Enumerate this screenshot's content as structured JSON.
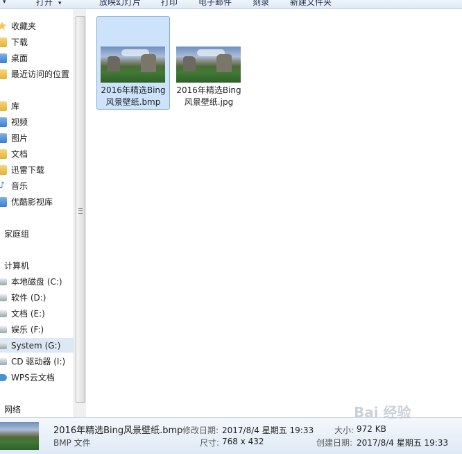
{
  "toolbar": {
    "items": [
      {
        "label": "打开"
      },
      {
        "label": "放映幻灯片"
      },
      {
        "label": "打印"
      },
      {
        "label": "电子邮件"
      },
      {
        "label": "刻录"
      },
      {
        "label": "新建文件夹"
      }
    ]
  },
  "nav": {
    "favorites": "收藏夹",
    "downloads": "下载",
    "desktop": "桌面",
    "recent": "最近访问的位置",
    "libraries": "库",
    "videos": "视频",
    "pictures": "图片",
    "documents": "文档",
    "xunlei": "迅雷下载",
    "music": "音乐",
    "youku": "优酷影视库",
    "homegroup": "家庭组",
    "computer": "计算机",
    "drive_c": "本地磁盘 (C:)",
    "drive_d": "软件 (D:)",
    "drive_e": "文档 (E:)",
    "drive_f": "娱乐 (F:)",
    "drive_g": "System (G:)",
    "drive_i": "CD 驱动器 (I:)",
    "wps": "WPS云文档",
    "network": "网络"
  },
  "files": [
    {
      "line1": "2016年精选Bing",
      "line2": "风景壁纸.bmp",
      "selected": true
    },
    {
      "line1": "2016年精选Bing",
      "line2": "风景壁纸.jpg",
      "selected": false
    }
  ],
  "details": {
    "name": "2016年精选Bing风景壁纸.bmp",
    "type": "BMP 文件",
    "modified_label": "修改日期:",
    "modified_value": "2017/8/4 星期五 19:33",
    "size_label": "大小:",
    "size_value": "972 KB",
    "dimensions_label": "尺寸:",
    "dimensions_value": "768 x 432",
    "created_label": "创建日期:",
    "created_value": "2017/8/4 星期五 19:33"
  },
  "watermark": "Bai 经验"
}
